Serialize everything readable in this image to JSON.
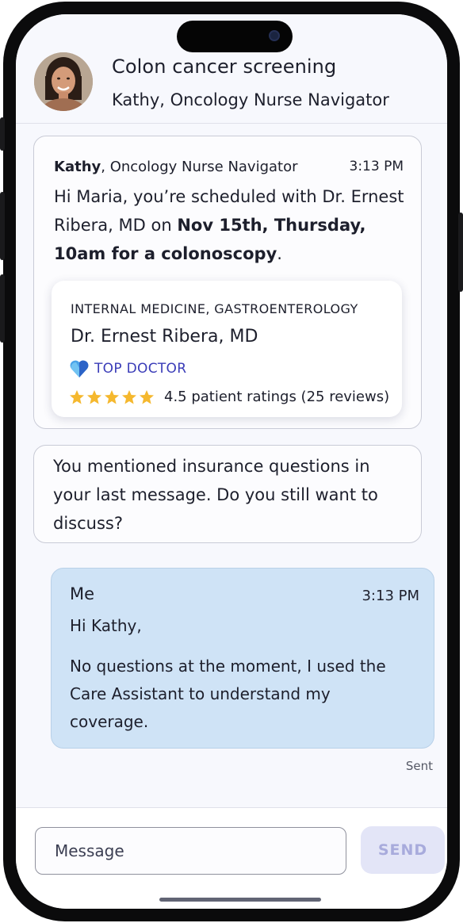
{
  "header": {
    "title": "Colon cancer screening",
    "subtitle": "Kathy, Oncology Nurse Navigator"
  },
  "message1": {
    "sender_name": "Kathy",
    "sender_role": ", Oncology Nurse Navigator",
    "time": "3:13 PM",
    "text_pre": "Hi Maria, you’re scheduled with Dr. Ernest Ribera, MD on ",
    "text_bold": "Nov 15th, Thursday, 10am for a colonoscopy",
    "text_post": ".",
    "doctor_card": {
      "specialty": "INTERNAL MEDICINE, GASTROENTEROLOGY",
      "name": "Dr. Ernest Ribera, MD",
      "badge": "TOP DOCTOR",
      "rating_stars": 5,
      "rating_text": "4.5 patient ratings (25 reviews)"
    }
  },
  "message2": {
    "text": "You mentioned insurance questions in your last message. Do you still want to discuss?"
  },
  "my_message": {
    "sender": "Me",
    "time": "3:13 PM",
    "greeting": "Hi Kathy,",
    "text": "No questions at the moment, I used the Care Assistant to understand my coverage.",
    "status": "Sent"
  },
  "composer": {
    "placeholder": "Message",
    "send_label": "SEND"
  },
  "colors": {
    "accent": "#3a3cb8",
    "my_bubble": "#cfe3f6",
    "star": "#f5b82e",
    "send_disabled": "#e3e5f7"
  },
  "icons": [
    "top-doctor-heart-icon",
    "star-icon"
  ]
}
